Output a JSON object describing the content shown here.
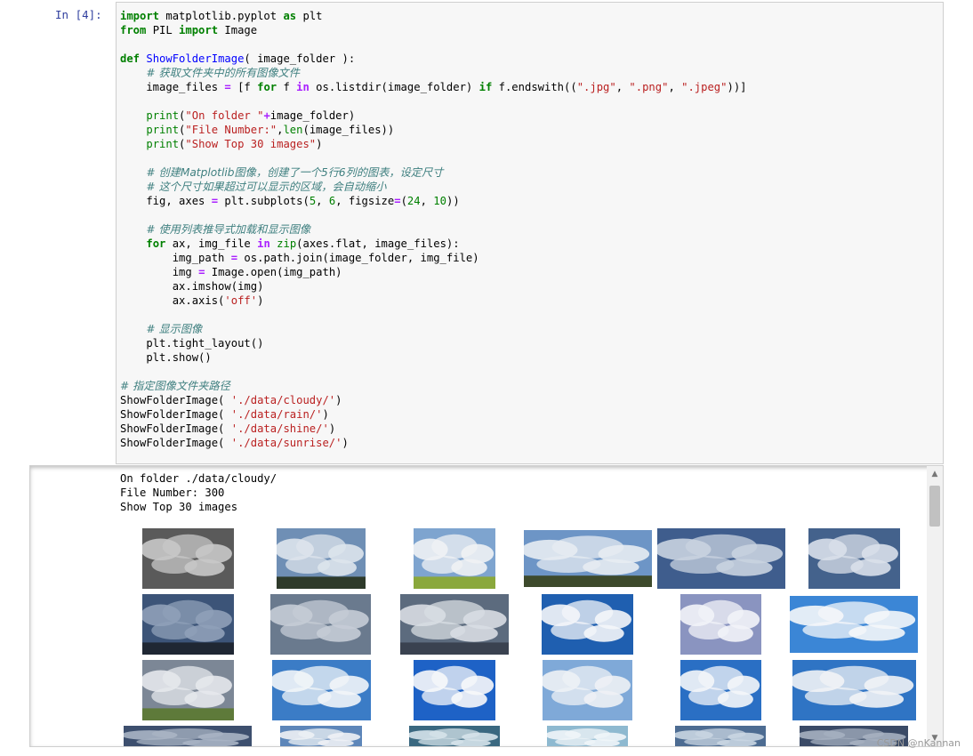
{
  "cell": {
    "prompt": "In [4]:",
    "code_lines": [
      [
        {
          "t": "import",
          "c": "kw"
        },
        {
          "t": " matplotlib.pyplot "
        },
        {
          "t": "as",
          "c": "kw"
        },
        {
          "t": " plt"
        }
      ],
      [
        {
          "t": "from",
          "c": "kw"
        },
        {
          "t": " PIL "
        },
        {
          "t": "import",
          "c": "kw"
        },
        {
          "t": " Image"
        }
      ],
      [],
      [
        {
          "t": "def",
          "c": "kw"
        },
        {
          "t": " "
        },
        {
          "t": "ShowFolderImage",
          "c": "fn"
        },
        {
          "t": "( image_folder ):"
        }
      ],
      [
        {
          "t": "    "
        },
        {
          "t": "# 获取文件夹中的所有图像文件",
          "c": "cm"
        }
      ],
      [
        {
          "t": "    image_files "
        },
        {
          "t": "=",
          "c": "op"
        },
        {
          "t": " [f "
        },
        {
          "t": "for",
          "c": "kw"
        },
        {
          "t": " f "
        },
        {
          "t": "in",
          "c": "op"
        },
        {
          "t": " os.listdir(image_folder) "
        },
        {
          "t": "if",
          "c": "kw"
        },
        {
          "t": " f.endswith(("
        },
        {
          "t": "\".jpg\"",
          "c": "st"
        },
        {
          "t": ", "
        },
        {
          "t": "\".png\"",
          "c": "st"
        },
        {
          "t": ", "
        },
        {
          "t": "\".jpeg\"",
          "c": "st"
        },
        {
          "t": "))]"
        }
      ],
      [],
      [
        {
          "t": "    "
        },
        {
          "t": "print",
          "c": "bi"
        },
        {
          "t": "("
        },
        {
          "t": "\"On folder \"",
          "c": "st"
        },
        {
          "t": "+",
          "c": "op"
        },
        {
          "t": "image_folder)"
        }
      ],
      [
        {
          "t": "    "
        },
        {
          "t": "print",
          "c": "bi"
        },
        {
          "t": "("
        },
        {
          "t": "\"File Number:\"",
          "c": "st"
        },
        {
          "t": ","
        },
        {
          "t": "len",
          "c": "bi"
        },
        {
          "t": "(image_files))"
        }
      ],
      [
        {
          "t": "    "
        },
        {
          "t": "print",
          "c": "bi"
        },
        {
          "t": "("
        },
        {
          "t": "\"Show Top 30 images\"",
          "c": "st"
        },
        {
          "t": ")"
        }
      ],
      [],
      [
        {
          "t": "    "
        },
        {
          "t": "# 创建Matplotlib图像，创建了一个5行6列的图表，设定尺寸",
          "c": "cm"
        }
      ],
      [
        {
          "t": "    "
        },
        {
          "t": "# 这个尺寸如果超过可以显示的区域，会自动缩小",
          "c": "cm"
        }
      ],
      [
        {
          "t": "    fig, axes "
        },
        {
          "t": "=",
          "c": "op"
        },
        {
          "t": " plt.subplots("
        },
        {
          "t": "5",
          "c": "nm"
        },
        {
          "t": ", "
        },
        {
          "t": "6",
          "c": "nm"
        },
        {
          "t": ", figsize"
        },
        {
          "t": "=",
          "c": "op"
        },
        {
          "t": "("
        },
        {
          "t": "24",
          "c": "nm"
        },
        {
          "t": ", "
        },
        {
          "t": "10",
          "c": "nm"
        },
        {
          "t": "))"
        }
      ],
      [],
      [
        {
          "t": "    "
        },
        {
          "t": "# 使用列表推导式加载和显示图像",
          "c": "cm"
        }
      ],
      [
        {
          "t": "    "
        },
        {
          "t": "for",
          "c": "kw"
        },
        {
          "t": " ax, img_file "
        },
        {
          "t": "in",
          "c": "op"
        },
        {
          "t": " "
        },
        {
          "t": "zip",
          "c": "bi"
        },
        {
          "t": "(axes.flat, image_files):"
        }
      ],
      [
        {
          "t": "        img_path "
        },
        {
          "t": "=",
          "c": "op"
        },
        {
          "t": " os.path.join(image_folder, img_file)"
        }
      ],
      [
        {
          "t": "        img "
        },
        {
          "t": "=",
          "c": "op"
        },
        {
          "t": " Image.open(img_path)"
        }
      ],
      [
        {
          "t": "        ax.imshow(img)"
        }
      ],
      [
        {
          "t": "        ax.axis("
        },
        {
          "t": "'off'",
          "c": "st"
        },
        {
          "t": ")"
        }
      ],
      [],
      [
        {
          "t": "    "
        },
        {
          "t": "# 显示图像",
          "c": "cm"
        }
      ],
      [
        {
          "t": "    plt.tight_layout()"
        }
      ],
      [
        {
          "t": "    plt.show()"
        }
      ],
      [],
      [
        {
          "t": "# 指定图像文件夹路径",
          "c": "cm"
        }
      ],
      [
        {
          "t": "ShowFolderImage( "
        },
        {
          "t": "'./data/cloudy/'",
          "c": "st"
        },
        {
          "t": ")"
        }
      ],
      [
        {
          "t": "ShowFolderImage( "
        },
        {
          "t": "'./data/rain/'",
          "c": "st"
        },
        {
          "t": ")"
        }
      ],
      [
        {
          "t": "ShowFolderImage( "
        },
        {
          "t": "'./data/shine/'",
          "c": "st"
        },
        {
          "t": ")"
        }
      ],
      [
        {
          "t": "ShowFolderImage( "
        },
        {
          "t": "'./data/sunrise/'",
          "c": "st"
        },
        {
          "t": ")"
        }
      ]
    ]
  },
  "output": {
    "lines": [
      "On folder ./data/cloudy/",
      "File Number: 300",
      "Show Top 30 images"
    ],
    "grid": {
      "rows": [
        [
          {
            "sky": "#5a5a5a",
            "cloud": "#c8c8c8",
            "ground": ""
          },
          {
            "sky": "#6f8fb5",
            "cloud": "#dde4ec",
            "ground": "#2e3a2a"
          },
          {
            "sky": "#7ea4cf",
            "cloud": "#f0f2f4",
            "ground": "#8aa83c"
          },
          {
            "sky": "#6d95c6",
            "cloud": "#e7ecf2",
            "ground": "#3d4a2c"
          },
          {
            "sky": "#3f5d8d",
            "cloud": "#c9d3e0",
            "ground": ""
          },
          {
            "sky": "#44628c",
            "cloud": "#d9e0ea",
            "ground": ""
          }
        ],
        [
          {
            "sky": "#3c5478",
            "cloud": "#8fa0b8",
            "ground": "#1f2733"
          },
          {
            "sky": "#6a7a8e",
            "cloud": "#c5ccd6",
            "ground": ""
          },
          {
            "sky": "#5c6b7e",
            "cloud": "#d8dde3",
            "ground": "#3a4250"
          },
          {
            "sky": "#1f5fb0",
            "cloud": "#f4f6f9",
            "ground": ""
          },
          {
            "sky": "#8a94c0",
            "cloud": "#f2f3f8",
            "ground": ""
          },
          {
            "sky": "#3b86d6",
            "cloud": "#f5f7fa",
            "ground": ""
          }
        ],
        [
          {
            "sky": "#7c8796",
            "cloud": "#e5e8ec",
            "ground": "#5e7a3a"
          },
          {
            "sky": "#3b7cc6",
            "cloud": "#f2f5f8",
            "ground": ""
          },
          {
            "sky": "#1e62c6",
            "cloud": "#f7f8fa",
            "ground": ""
          },
          {
            "sky": "#7fa9d8",
            "cloud": "#eef1f5",
            "ground": ""
          },
          {
            "sky": "#2a6fc4",
            "cloud": "#f4f6f9",
            "ground": ""
          },
          {
            "sky": "#2f74c4",
            "cloud": "#f1f3f6",
            "ground": ""
          }
        ],
        [
          {
            "sky": "#3d4f6e",
            "cloud": "#a9b4c4",
            "ground": ""
          },
          {
            "sky": "#5d86b9",
            "cloud": "#eef1f5",
            "ground": ""
          },
          {
            "sky": "#3a6880",
            "cloud": "#d6e3ea",
            "ground": ""
          },
          {
            "sky": "#8eb9d0",
            "cloud": "#f0f5f8",
            "ground": ""
          },
          {
            "sky": "#4d6c92",
            "cloud": "#c9d6e2",
            "ground": ""
          },
          {
            "sky": "#3a4a66",
            "cloud": "#a6b0c0",
            "ground": ""
          }
        ]
      ]
    }
  },
  "watermark": "CSDN @nKannan",
  "icons": {
    "scroll_up": "triangle-up",
    "scroll_down": "triangle-down"
  }
}
